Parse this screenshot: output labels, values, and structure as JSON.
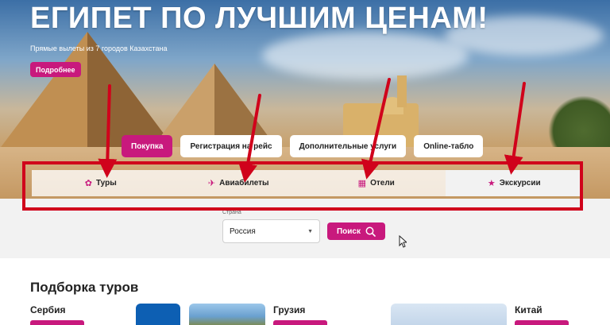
{
  "hero": {
    "title": "ЕГИПЕТ ПО ЛУЧШИМ ЦЕНАМ!",
    "subtitle": "Прямые вылеты из 7 городов Казахстана",
    "more_label": "Подробнее"
  },
  "actions": [
    {
      "label": "Покупка",
      "active": true
    },
    {
      "label": "Регистрация на рейс",
      "active": false
    },
    {
      "label": "Дополнительные услуги",
      "active": false
    },
    {
      "label": "Online-табло",
      "active": false
    }
  ],
  "tabs": [
    {
      "label": "Туры",
      "icon": "palm-icon",
      "active": false
    },
    {
      "label": "Авиабилеты",
      "icon": "plane-icon",
      "active": false
    },
    {
      "label": "Отели",
      "icon": "hotel-icon",
      "active": false
    },
    {
      "label": "Экскурсии",
      "icon": "star-icon",
      "active": true
    }
  ],
  "search": {
    "country_label": "Страна",
    "country_value": "Россия",
    "button_label": "Поиск"
  },
  "tours": {
    "title": "Подборка туров",
    "cards": [
      {
        "name": "Сербия"
      },
      {
        "name": "Грузия"
      },
      {
        "name": "Китай"
      }
    ]
  },
  "colors": {
    "accent": "#c8197d",
    "annotation": "#d0021b"
  }
}
